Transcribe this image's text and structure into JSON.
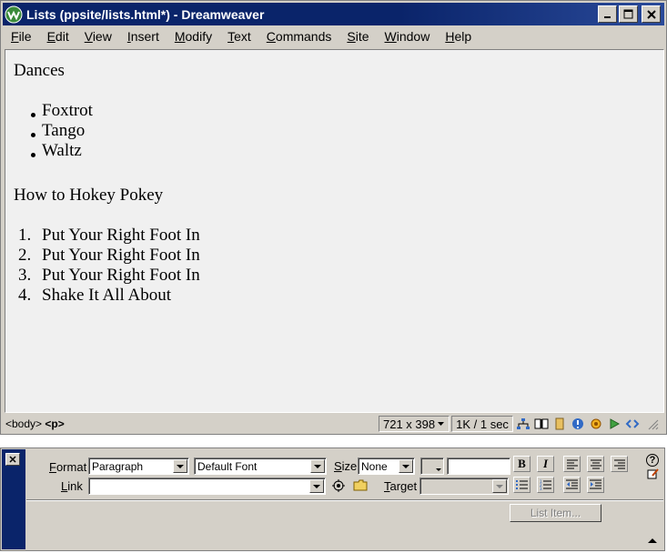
{
  "window": {
    "title": "Lists (ppsite/lists.html*) - Dreamweaver",
    "minimize": "_",
    "maximize": "□",
    "close": "✕"
  },
  "menu": [
    {
      "pre": "",
      "ul": "F",
      "post": "ile"
    },
    {
      "pre": "",
      "ul": "E",
      "post": "dit"
    },
    {
      "pre": "",
      "ul": "V",
      "post": "iew"
    },
    {
      "pre": "",
      "ul": "I",
      "post": "nsert"
    },
    {
      "pre": "",
      "ul": "M",
      "post": "odify"
    },
    {
      "pre": "",
      "ul": "T",
      "post": "ext"
    },
    {
      "pre": "",
      "ul": "C",
      "post": "ommands"
    },
    {
      "pre": "",
      "ul": "S",
      "post": "ite"
    },
    {
      "pre": "",
      "ul": "W",
      "post": "indow"
    },
    {
      "pre": "",
      "ul": "H",
      "post": "elp"
    }
  ],
  "document": {
    "heading1": "Dances",
    "bullets": [
      "Foxtrot",
      "Tango",
      "Waltz"
    ],
    "heading2": "How to Hokey Pokey",
    "numbers": [
      "1.",
      "2.",
      "3.",
      "4."
    ],
    "steps": [
      "Put Your Right Foot In",
      "Put Your Right Foot In",
      "Put Your Right Foot In",
      "Shake It All About"
    ]
  },
  "status": {
    "tag_body": "<body>",
    "tag_p": "<p>",
    "window_size": "721 x 398",
    "download": "1K / 1 sec"
  },
  "inspector": {
    "close": "✕",
    "format_label_ul": "F",
    "format_label_rest": "ormat",
    "format_value": "Paragraph",
    "font_value": "Default Font",
    "size_label_ul": "S",
    "size_label_rest": "ize",
    "size_value": "None",
    "link_label_ul": "L",
    "link_label_rest": "ink",
    "link_value": "",
    "target_label_ul": "T",
    "target_label_rest": "arget",
    "bold": "B",
    "italic": "I",
    "help": "?",
    "list_item_button": "List Item..."
  }
}
